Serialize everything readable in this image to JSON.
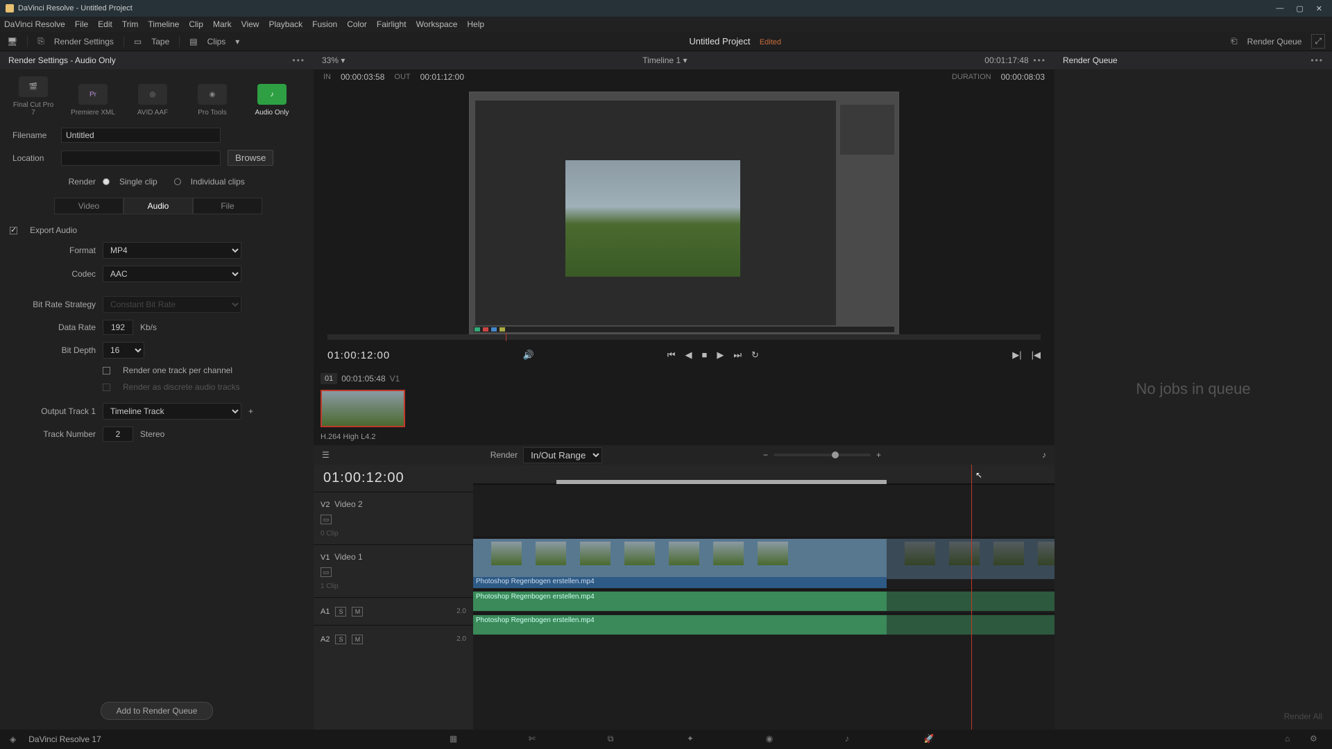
{
  "window": {
    "title": "DaVinci Resolve - Untitled Project"
  },
  "menu": [
    "DaVinci Resolve",
    "File",
    "Edit",
    "Trim",
    "Timeline",
    "Clip",
    "Mark",
    "View",
    "Playback",
    "Fusion",
    "Color",
    "Fairlight",
    "Workspace",
    "Help"
  ],
  "toolbar": {
    "render_settings": "Render Settings",
    "tape": "Tape",
    "clips": "Clips",
    "project": "Untitled Project",
    "edited": "Edited",
    "render_queue": "Render Queue"
  },
  "left": {
    "title": "Render Settings - Audio Only",
    "presets": [
      {
        "label": "Final Cut Pro 7",
        "active": false,
        "glyph": "FC"
      },
      {
        "label": "Premiere XML",
        "active": false,
        "glyph": "Pr"
      },
      {
        "label": "AVID AAF",
        "active": false,
        "glyph": "AA"
      },
      {
        "label": "Pro Tools",
        "active": false,
        "glyph": "PT"
      },
      {
        "label": "Audio Only",
        "active": true,
        "glyph": "♪"
      }
    ],
    "filename_label": "Filename",
    "filename": "Untitled",
    "location_label": "Location",
    "location": "",
    "browse": "Browse",
    "render_label": "Render",
    "single_clip": "Single clip",
    "individual": "Individual clips",
    "tabs": [
      "Video",
      "Audio",
      "File"
    ],
    "active_tab": "Audio",
    "export_audio": "Export Audio",
    "format_label": "Format",
    "format": "MP4",
    "codec_label": "Codec",
    "codec": "AAC",
    "bitrate_strategy_label": "Bit Rate Strategy",
    "bitrate_strategy": "Constant Bit Rate",
    "data_rate_label": "Data Rate",
    "data_rate": "192",
    "data_rate_unit": "Kb/s",
    "bit_depth_label": "Bit Depth",
    "bit_depth": "16",
    "one_track": "Render one track per channel",
    "discrete": "Render as discrete audio tracks",
    "output_track_label": "Output Track 1",
    "output_track": "Timeline Track",
    "track_number_label": "Track Number",
    "track_number": "2",
    "stereo": "Stereo",
    "add_to_queue": "Add to Render Queue"
  },
  "viewer": {
    "zoom": "33%",
    "timeline_name": "Timeline 1",
    "current_tc": "00:01:17:48",
    "in_label": "IN",
    "in_tc": "00:00:03:58",
    "out_label": "OUT",
    "out_tc": "00:01:12:00",
    "duration_label": "DURATION",
    "duration": "00:00:08:03",
    "transport_tc": "01:00:12:00"
  },
  "media": {
    "index": "01",
    "tc": "00:01:05:48",
    "track": "V1",
    "codec": "H.264 High L4.2"
  },
  "timeline": {
    "render_label": "Render",
    "range": "In/Out Range",
    "tc": "01:00:12:00",
    "tracks": {
      "v2": {
        "tag": "V2",
        "name": "Video 2",
        "clips_info": "0 Clip"
      },
      "v1": {
        "tag": "V1",
        "name": "Video 1",
        "clips_info": "1 Clip"
      },
      "a1": {
        "tag": "A1",
        "level": "2.0"
      },
      "a2": {
        "tag": "A2",
        "level": "2.0"
      }
    },
    "clip_name": "Photoshop Regenbogen erstellen.mp4"
  },
  "queue": {
    "title": "Render Queue",
    "empty": "No jobs in queue",
    "render_all": "Render All"
  },
  "footer": {
    "version": "DaVinci Resolve 17"
  }
}
